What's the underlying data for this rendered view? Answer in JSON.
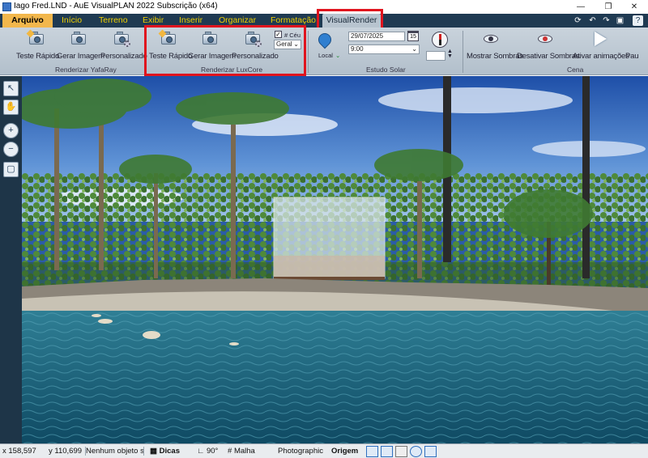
{
  "window": {
    "title": "Iago Fred.LND - AuE VisualPLAN 2022 Subscrição (x64)",
    "buttons": {
      "minimize": "—",
      "maximize": "❐",
      "close": "✕"
    }
  },
  "menu": {
    "file": "Arquivo",
    "tabs": [
      "Início",
      "Terreno",
      "Exibir",
      "Inserir",
      "Organizar",
      "Formatação",
      "VisualRender"
    ],
    "active": "VisualRender"
  },
  "quick_access": [
    "refresh-icon",
    "undo-icon",
    "redo-icon",
    "save-icon",
    "help-icon"
  ],
  "ribbon": {
    "yafaray": {
      "label": "Renderizar YafaRay",
      "buttons": [
        "Teste Rápido",
        "Gerar Imagem",
        "Personalizado"
      ]
    },
    "luxcore": {
      "label": "Renderizar LuxCore",
      "buttons": [
        "Teste Rápido",
        "Gerar Imagem",
        "Personalizado"
      ],
      "sky_checkbox": "# Céu",
      "sky_checked": true,
      "quality_select": "Geral"
    },
    "solar": {
      "label": "Estudo Solar",
      "location": "Local",
      "date": "29/07/2025",
      "calendar_day": "15",
      "time": "9:00"
    },
    "scene": {
      "label": "Cena",
      "buttons": [
        "Mostrar Sombras",
        "Desativar Sombras",
        "Ativar animações",
        "Pau"
      ]
    }
  },
  "status": {
    "x": "x 158,597",
    "y": "y 110,699",
    "selection": "Nenhum objeto sel",
    "tips": "Dicas",
    "angle": "90°",
    "grid": "Malha",
    "render_mode": "Photographic",
    "origin": "Origem"
  },
  "colors": {
    "menubar": "#1f3a52",
    "ribbon": "#c0cbd5",
    "highlight": "#e0141e",
    "tab_text": "#f0d000"
  }
}
